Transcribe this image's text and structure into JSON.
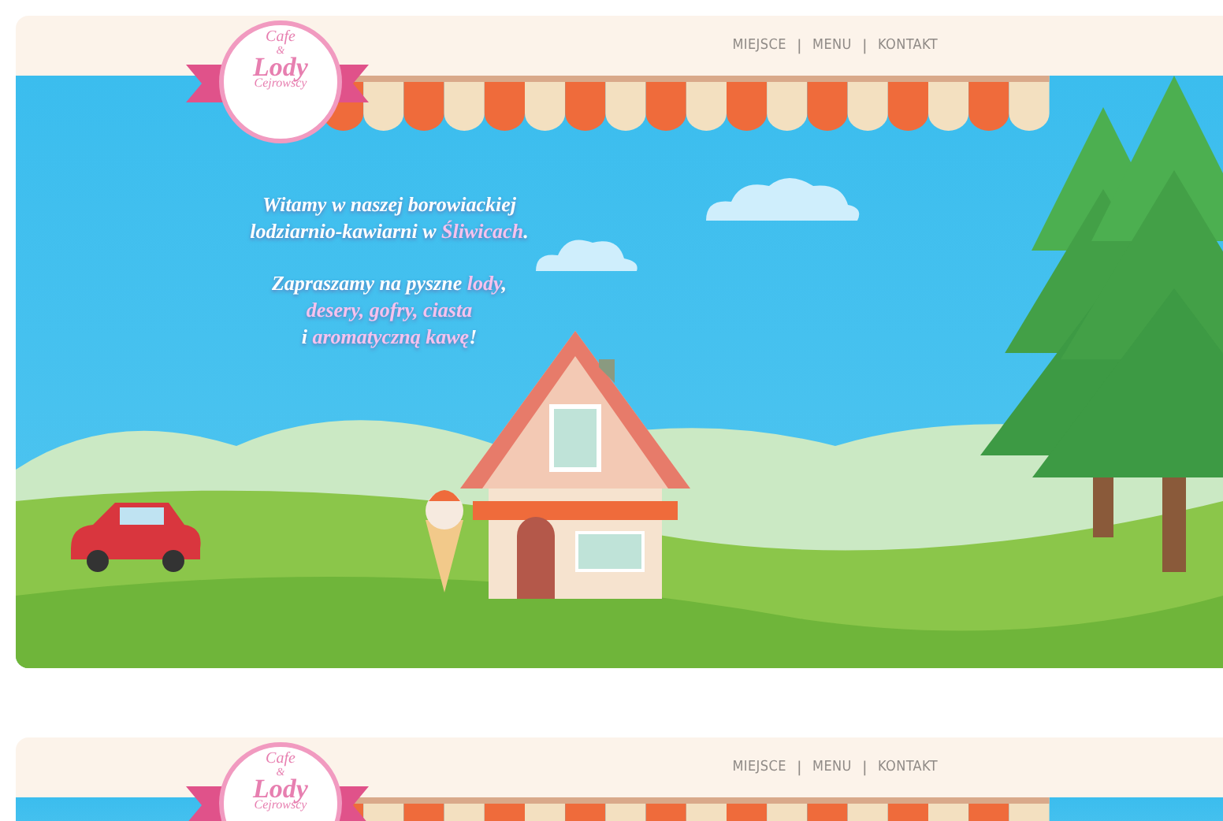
{
  "sections": [
    {
      "kind": "full",
      "logo": {
        "line_1": "Cafe",
        "line_2": "&",
        "line_3": "Lody",
        "line_4": "Cejrowscy"
      },
      "nav": {
        "items": [
          {
            "label": "MIEJSCE"
          },
          {
            "label": "MENU"
          },
          {
            "label": "KONTAKT"
          }
        ],
        "separator": "|"
      },
      "intro": [
        [
          [
            {
              "text": "Witamy w naszej borowiackiej",
              "highlight": false
            }
          ],
          [
            {
              "text": "lodziarnio-kawiarni w ",
              "highlight": false
            },
            {
              "text": "Śliwicach",
              "highlight": true
            },
            {
              "text": ".",
              "highlight": false
            }
          ]
        ],
        [
          [
            {
              "text": "Zapraszamy na pyszne ",
              "highlight": false
            },
            {
              "text": "lody",
              "highlight": true
            },
            {
              "text": ",",
              "highlight": false
            }
          ],
          [
            {
              "text": "desery, gofry, ciasta",
              "highlight": true
            }
          ],
          [
            {
              "text": "i ",
              "highlight": false
            },
            {
              "text": "aromatyczną kawę",
              "highlight": true
            },
            {
              "text": "!",
              "highlight": false
            }
          ]
        ]
      ]
    },
    {
      "kind": "teaser",
      "logo": {
        "line_1": "Cafe",
        "line_2": "&",
        "line_3": "Lody",
        "line_4": "Cejrowscy"
      },
      "nav": {
        "items": [
          {
            "label": "MIEJSCE"
          },
          {
            "label": "MENU"
          },
          {
            "label": "KONTAKT"
          }
        ],
        "separator": "|"
      }
    }
  ]
}
